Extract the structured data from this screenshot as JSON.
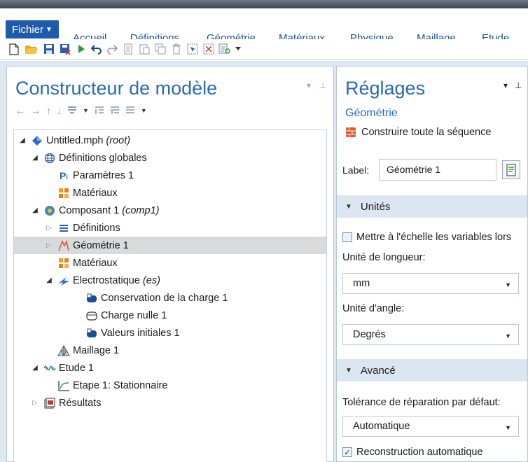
{
  "ribbon": {
    "file_tab": "Fichier",
    "tabs": [
      "Accueil",
      "Définitions",
      "Géométrie",
      "Matériaux",
      "Physique",
      "Maillage",
      "Etude"
    ]
  },
  "quick_toolbar": {
    "icons": [
      "new-file-icon",
      "open-folder-icon",
      "save-icon",
      "save-as-icon",
      "run-icon",
      "undo-icon",
      "redo-icon",
      "copy-icon",
      "paste-icon",
      "duplicate-icon",
      "delete-icon",
      "select-icon",
      "deselect-icon",
      "properties-icon",
      "more-icon"
    ]
  },
  "model_builder": {
    "title": "Constructeur de modèle",
    "toolbar_icons": [
      "back-arrow-icon",
      "forward-arrow-icon",
      "up-arrow-icon",
      "down-arrow-icon",
      "filter-icon",
      "dropdown-icon",
      "expand-icon",
      "collapse-icon",
      "list-icon",
      "dropdown-icon"
    ],
    "tree": [
      {
        "label": "Untitled.mph",
        "suffix": "(root)",
        "expanded": true,
        "icon": "model-icon"
      },
      {
        "label": "Définitions globales",
        "expanded": true,
        "icon": "globe-icon"
      },
      {
        "label": "Paramètres 1",
        "icon": "parameters-icon"
      },
      {
        "label": "Matériaux",
        "icon": "materials-icon"
      },
      {
        "label": "Composant 1",
        "suffix": "(comp1)",
        "expanded": true,
        "icon": "component-icon"
      },
      {
        "label": "Définitions",
        "collapsed": true,
        "icon": "definitions-icon"
      },
      {
        "label": "Géométrie 1",
        "collapsed": true,
        "selected": true,
        "icon": "geometry-icon"
      },
      {
        "label": "Matériaux",
        "icon": "materials-icon"
      },
      {
        "label": "Electrostatique",
        "suffix": "(es)",
        "expanded": true,
        "icon": "electrostatics-icon"
      },
      {
        "label": "Conservation de la charge 1",
        "icon": "domain-feature-icon"
      },
      {
        "label": "Charge nulle 1",
        "icon": "boundary-feature-icon"
      },
      {
        "label": "Valeurs initiales 1",
        "icon": "domain-feature-icon"
      },
      {
        "label": "Maillage 1",
        "icon": "mesh-icon"
      },
      {
        "label": "Etude 1",
        "expanded": true,
        "icon": "study-icon"
      },
      {
        "label": "Etape 1: Stationnaire",
        "icon": "stationary-step-icon"
      },
      {
        "label": "Résultats",
        "collapsed": true,
        "icon": "results-icon"
      }
    ]
  },
  "settings": {
    "title": "Réglages",
    "subtitle": "Géométrie",
    "build_all": "Construire toute la séquence",
    "label_caption": "Label:",
    "label_value": "Géométrie 1",
    "units_section": "Unités",
    "scale_checkbox": "Mettre à l'échelle les variables lors",
    "scale_checked": false,
    "length_unit_label": "Unité de longueur:",
    "length_unit_value": "mm",
    "angle_unit_label": "Unité d'angle:",
    "angle_unit_value": "Degrés",
    "advanced_section": "Avancé",
    "tolerance_label": "Tolérance de réparation par défaut:",
    "tolerance_value": "Automatique",
    "auto_rebuild": "Reconstruction automatique",
    "auto_rebuild_checked": true
  },
  "colors": {
    "accent": "#2b69b3",
    "file_tab": "#1f5bad",
    "section_header": "#dbe6f1",
    "selection": "#d9dadc"
  }
}
